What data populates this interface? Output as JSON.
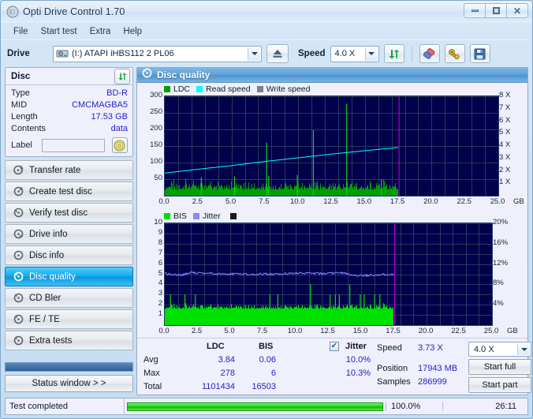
{
  "window": {
    "title": "Opti Drive Control 1.70",
    "app_icon": "disc-icon",
    "minimize": "minimize-icon",
    "maximize": "maximize-icon",
    "close": "close-icon"
  },
  "menu": {
    "items": [
      "File",
      "Start test",
      "Extra",
      "Help"
    ]
  },
  "toolbar": {
    "drive_label": "Drive",
    "drive_value": "(I:)  ATAPI iHBS112  2 PL06",
    "eject_icon": "eject-icon",
    "speed_label": "Speed",
    "speed_value": "4.0 X",
    "refresh_icon": "refresh-icon",
    "erase_icon": "eraser-icon",
    "tools_icon": "wrench-icon",
    "save_icon": "save-icon"
  },
  "disc": {
    "panel_title": "Disc",
    "refresh_icon": "refresh-disc-icon",
    "rows": [
      {
        "key": "Type",
        "value": "BD-R"
      },
      {
        "key": "MID",
        "value": "CMCMAGBA5"
      },
      {
        "key": "Length",
        "value": "17.53 GB"
      },
      {
        "key": "Contents",
        "value": "data"
      }
    ],
    "label_key": "Label",
    "label_value": "",
    "label_placeholder": "",
    "disc_icon": "cd-icon"
  },
  "nav": {
    "items": [
      {
        "label": "Transfer rate",
        "icon": "disc-speed-icon",
        "active": false
      },
      {
        "label": "Create test disc",
        "icon": "disc-burn-icon",
        "active": false
      },
      {
        "label": "Verify test disc",
        "icon": "disc-check-icon",
        "active": false
      },
      {
        "label": "Drive info",
        "icon": "drive-info-icon",
        "active": false
      },
      {
        "label": "Disc info",
        "icon": "disc-info-icon",
        "active": false
      },
      {
        "label": "Disc quality",
        "icon": "disc-quality-icon",
        "active": true
      },
      {
        "label": "CD Bler",
        "icon": "disc-bler-icon",
        "active": false
      },
      {
        "label": "FE / TE",
        "icon": "disc-fete-icon",
        "active": false
      },
      {
        "label": "Extra tests",
        "icon": "disc-extra-icon",
        "active": false
      }
    ],
    "status_window": "Status window > >"
  },
  "quality": {
    "title": "Disc quality",
    "title_icon": "disc-quality-icon"
  },
  "stats": {
    "col_headers": [
      "LDC",
      "BIS"
    ],
    "jitter_label": "Jitter",
    "jitter_checked": true,
    "rows": [
      {
        "key": "Avg",
        "ldc": "3.84",
        "bis": "0.06",
        "jitter": "10.0%"
      },
      {
        "key": "Max",
        "ldc": "278",
        "bis": "6",
        "jitter": "10.3%"
      },
      {
        "key": "Total",
        "ldc": "1101434",
        "bis": "16503",
        "jitter": ""
      }
    ],
    "speed_key": "Speed",
    "speed_value": "3.73 X",
    "position_key": "Position",
    "position_value": "17943 MB",
    "samples_key": "Samples",
    "samples_value": "286999",
    "speed_select": "4.0 X",
    "start_full": "Start full",
    "start_part": "Start part"
  },
  "statusbar": {
    "text": "Test completed",
    "percent": "100.0%",
    "progress": 100,
    "time": "26:11"
  },
  "colors": {
    "ldc_green": "#00a000",
    "ldc_bar": "#00e000",
    "read_speed_cyan": "#00ffff",
    "write_speed_gray": "#808080",
    "bis_green": "#00e000",
    "jitter_blue": "#8888ff",
    "plot_bg": "#00004b",
    "marker_magenta": "#cc00cc",
    "accent_blue": "#2222cc",
    "nav_active": "#17a8ec"
  },
  "chart_data": [
    {
      "type": "line",
      "name": "ldc-chart",
      "title": "",
      "legend": [
        {
          "label": "LDC",
          "color": "#00a000"
        },
        {
          "label": "Read speed",
          "color": "#00ffff"
        },
        {
          "label": "Write speed",
          "color": "#808080"
        }
      ],
      "legend_position": "top-left",
      "grid": true,
      "xlabel": "GB",
      "xlim": [
        0,
        25
      ],
      "xticks": [
        "0.0",
        "2.5",
        "5.0",
        "7.5",
        "10.0",
        "12.5",
        "15.0",
        "17.5",
        "20.0",
        "22.5",
        "25.0"
      ],
      "ylabel": "",
      "ylim": [
        0,
        300
      ],
      "yticks": [
        50,
        100,
        150,
        200,
        250,
        300
      ],
      "y2label": "",
      "y2lim": [
        0,
        8
      ],
      "y2ticks": [
        "1 X",
        "2 X",
        "3 X",
        "4 X",
        "5 X",
        "6 X",
        "7 X",
        "8 X"
      ],
      "data_end_gb": 17.53,
      "series": [
        {
          "name": "LDC",
          "color": "#00a000",
          "type": "bar",
          "baseline_avg": 18,
          "noise_amplitude": 35,
          "spikes": [
            {
              "x": 2.7,
              "y": 55
            },
            {
              "x": 7.6,
              "y": 160
            },
            {
              "x": 7.75,
              "y": 60
            },
            {
              "x": 11.1,
              "y": 198
            },
            {
              "x": 13.6,
              "y": 278
            },
            {
              "x": 5.2,
              "y": 58
            },
            {
              "x": 9.9,
              "y": 62
            },
            {
              "x": 16.2,
              "y": 50
            }
          ]
        },
        {
          "name": "Read speed",
          "color": "#00ffff",
          "type": "line",
          "points": [
            {
              "x": 0.0,
              "y_x": 1.82
            },
            {
              "x": 2.5,
              "y_x": 2.13
            },
            {
              "x": 5.0,
              "y_x": 2.42
            },
            {
              "x": 7.5,
              "y_x": 2.75
            },
            {
              "x": 10.0,
              "y_x": 3.05
            },
            {
              "x": 12.5,
              "y_x": 3.35
            },
            {
              "x": 15.0,
              "y_x": 3.62
            },
            {
              "x": 17.5,
              "y_x": 3.88
            }
          ]
        }
      ],
      "markers": [
        {
          "x": 17.53,
          "color": "#cc00cc",
          "label": "disc-end-marker"
        }
      ]
    },
    {
      "type": "line",
      "name": "bis-jitter-chart",
      "title": "",
      "legend": [
        {
          "label": "BIS",
          "color": "#00e000"
        },
        {
          "label": "Jitter",
          "color": "#8888ff"
        }
      ],
      "legend_position": "top-left",
      "grid": true,
      "xlabel": "GB",
      "xlim": [
        0,
        25
      ],
      "xticks": [
        "0.0",
        "2.5",
        "5.0",
        "7.5",
        "10.0",
        "12.5",
        "15.0",
        "17.5",
        "20.0",
        "22.5",
        "25.0"
      ],
      "ylabel": "",
      "ylim": [
        0,
        10
      ],
      "yticks": [
        1,
        2,
        3,
        4,
        5,
        6,
        7,
        8,
        9,
        10
      ],
      "y2label": "",
      "y2lim": [
        0,
        20
      ],
      "y2ticks": [
        "4%",
        "8%",
        "12%",
        "16%",
        "20%"
      ],
      "data_end_gb": 17.53,
      "series": [
        {
          "name": "BIS",
          "color": "#00e000",
          "type": "bar",
          "baseline_avg": 1.6,
          "noise_amplitude": 0.6,
          "spikes": [
            {
              "x": 0.4,
              "y": 3
            },
            {
              "x": 1.5,
              "y": 3
            },
            {
              "x": 2.3,
              "y": 3
            },
            {
              "x": 8.0,
              "y": 3
            },
            {
              "x": 8.6,
              "y": 3
            },
            {
              "x": 11.1,
              "y": 4
            },
            {
              "x": 12.6,
              "y": 3
            },
            {
              "x": 13.0,
              "y": 3
            },
            {
              "x": 13.3,
              "y": 3
            },
            {
              "x": 14.1,
              "y": 4
            },
            {
              "x": 14.9,
              "y": 3
            },
            {
              "x": 15.2,
              "y": 3
            },
            {
              "x": 16.0,
              "y": 3
            },
            {
              "x": 16.4,
              "y": 3
            }
          ]
        },
        {
          "name": "Jitter",
          "color": "#8888ff",
          "type": "line",
          "unit": "%",
          "points": [
            {
              "x": 0.0,
              "y_pct": 10.1
            },
            {
              "x": 1.2,
              "y_pct": 9.8
            },
            {
              "x": 2.0,
              "y_pct": 10.3
            },
            {
              "x": 4.0,
              "y_pct": 10.1
            },
            {
              "x": 6.0,
              "y_pct": 10.0
            },
            {
              "x": 8.0,
              "y_pct": 10.0
            },
            {
              "x": 10.0,
              "y_pct": 10.2
            },
            {
              "x": 12.0,
              "y_pct": 10.1
            },
            {
              "x": 13.5,
              "y_pct": 10.3
            },
            {
              "x": 14.6,
              "y_pct": 9.7
            },
            {
              "x": 15.4,
              "y_pct": 9.8
            },
            {
              "x": 17.5,
              "y_pct": 10.0
            }
          ]
        }
      ],
      "markers": [
        {
          "x": 17.53,
          "color": "#cc00cc",
          "label": "disc-end-marker"
        }
      ]
    }
  ]
}
